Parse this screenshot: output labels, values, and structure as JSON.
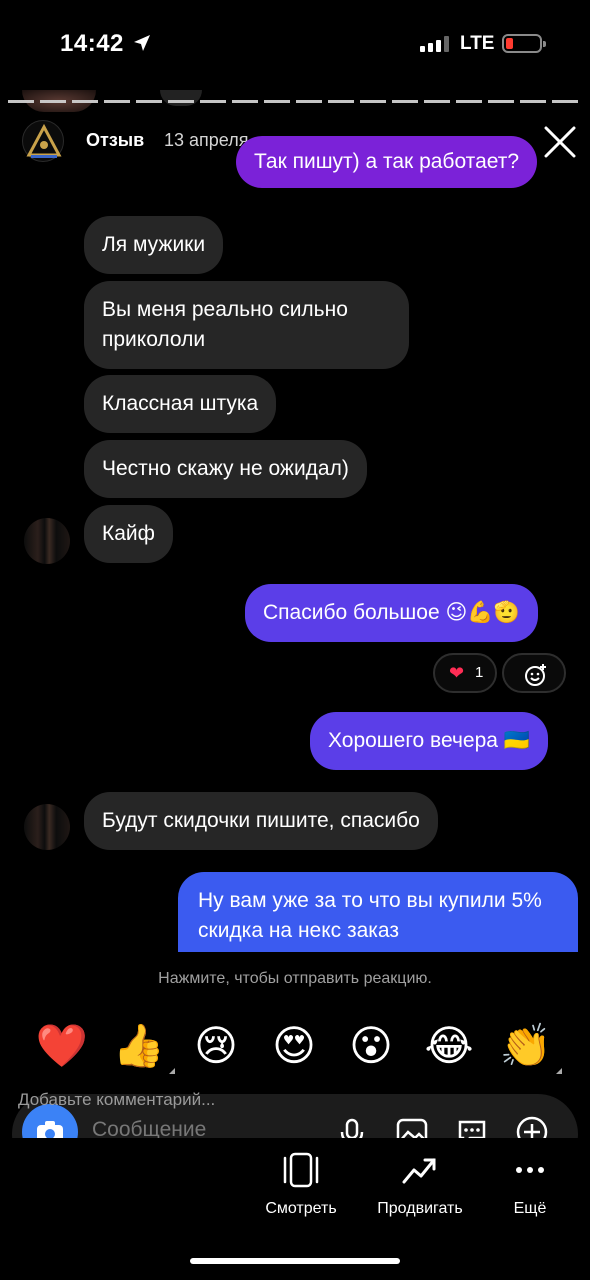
{
  "status_bar": {
    "time": "14:42",
    "carrier": "LTE"
  },
  "story": {
    "username": "Отзыв",
    "date": "13 апреля"
  },
  "messages": [
    {
      "text": "Так пишут) а так работает?"
    },
    {
      "text": "Ля мужики"
    },
    {
      "text": "Вы меня реально сильно прикололи"
    },
    {
      "text": "Классная штука"
    },
    {
      "text": "Честно скажу не ожидал)"
    },
    {
      "text": "Кайф"
    },
    {
      "text": "Спасибо большое 😉💪🫡"
    },
    {
      "text": "Хорошего вечера 🇺🇦"
    },
    {
      "text": "Будут скидочки пишите, спасибо"
    },
    {
      "text": "Ну вам уже за то что вы купили 5% скидка на некс заказ"
    }
  ],
  "reactions_on_message": {
    "emoji": "❤",
    "count": "1"
  },
  "reaction_hint": "Нажмите, чтобы отправить реакцию.",
  "quick_reactions": [
    "❤️",
    "👍",
    "😢",
    "😍",
    "😮",
    "😂",
    "👏"
  ],
  "comment_hint": "Добавьте комментарий...",
  "message_placeholder": "Сообщение",
  "actions": [
    {
      "label": "Смотреть",
      "icon": "view-icon"
    },
    {
      "label": "Продвигать",
      "icon": "trend-icon"
    },
    {
      "label": "Ещё",
      "icon": "more-icon"
    }
  ]
}
